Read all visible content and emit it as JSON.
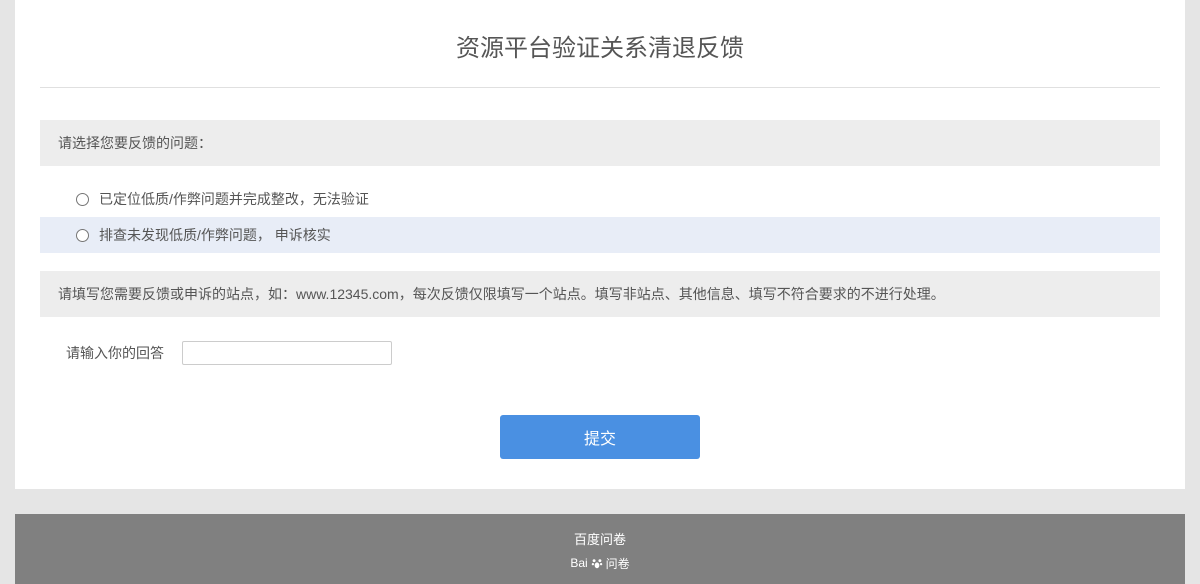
{
  "title": "资源平台验证关系清退反馈",
  "section1": {
    "header": "请选择您要反馈的问题：",
    "options": [
      {
        "label": "已定位低质/作弊问题并完成整改，无法验证"
      },
      {
        "label": "排查未发现低质/作弊问题，  申诉核实"
      }
    ]
  },
  "section2": {
    "instruction": "请填写您需要反馈或申诉的站点，如：www.12345.com，每次反馈仅限填写一个站点。填写非站点、其他信息、填写不符合要求的不进行处理。",
    "input_label": "请输入你的回答"
  },
  "submit_label": "提交",
  "footer": {
    "text": "百度问卷",
    "logo_prefix": "Bai",
    "logo_suffix": "问卷"
  }
}
